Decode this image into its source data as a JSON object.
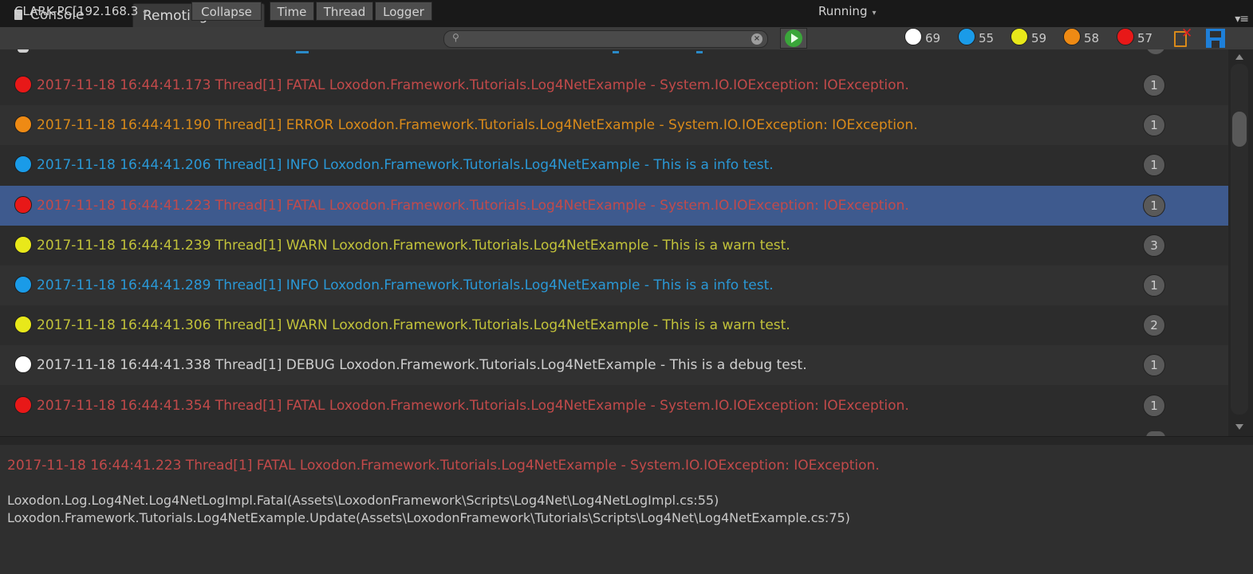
{
  "tabs": [
    {
      "label": "Console",
      "icon": "console-icon"
    },
    {
      "label": "Remoting"
    }
  ],
  "toolbar": {
    "device": "CLARK-PC[192.168.3",
    "collapse": "Collapse",
    "time": "Time",
    "thread": "Thread",
    "logger": "Logger",
    "search_value": "",
    "status": "Running",
    "counts": {
      "debug": "69",
      "info": "55",
      "warn": "59",
      "error": "58",
      "fatal": "57"
    }
  },
  "colors": {
    "debug": "#ffffff",
    "info": "#1a9be8",
    "warn": "#e8e81a",
    "error": "#ee8a14",
    "fatal": "#e81818",
    "text_fatal": "#c24a4a",
    "text_error": "#d98a1a",
    "text_info": "#2a98d6",
    "text_warn": "#c2c23a",
    "text_debug": "#cfcfcf",
    "selected_row": "#3e5a8e"
  },
  "log_rows": [
    {
      "level": "fatal",
      "text": "2017-11-18 16:44:41.173 Thread[1] FATAL Loxodon.Framework.Tutorials.Log4NetExample - System.IO.IOException: IOException.",
      "count": "1"
    },
    {
      "level": "error",
      "text": "2017-11-18 16:44:41.190 Thread[1] ERROR Loxodon.Framework.Tutorials.Log4NetExample - System.IO.IOException: IOException.",
      "count": "1"
    },
    {
      "level": "info",
      "text": "2017-11-18 16:44:41.206 Thread[1] INFO Loxodon.Framework.Tutorials.Log4NetExample - This is a info test.",
      "count": "1"
    },
    {
      "level": "fatal",
      "text": "2017-11-18 16:44:41.223 Thread[1] FATAL Loxodon.Framework.Tutorials.Log4NetExample - System.IO.IOException: IOException.",
      "count": "1",
      "selected": true
    },
    {
      "level": "warn",
      "text": "2017-11-18 16:44:41.239 Thread[1] WARN Loxodon.Framework.Tutorials.Log4NetExample - This is a warn test.",
      "count": "3"
    },
    {
      "level": "info",
      "text": "2017-11-18 16:44:41.289 Thread[1] INFO Loxodon.Framework.Tutorials.Log4NetExample - This is a info test.",
      "count": "1"
    },
    {
      "level": "warn",
      "text": "2017-11-18 16:44:41.306 Thread[1] WARN Loxodon.Framework.Tutorials.Log4NetExample - This is a warn test.",
      "count": "2"
    },
    {
      "level": "debug",
      "text": "2017-11-18 16:44:41.338 Thread[1] DEBUG Loxodon.Framework.Tutorials.Log4NetExample - This is a debug test.",
      "count": "1"
    },
    {
      "level": "fatal",
      "text": "2017-11-18 16:44:41.354 Thread[1] FATAL Loxodon.Framework.Tutorials.Log4NetExample - System.IO.IOException: IOException.",
      "count": "1"
    }
  ],
  "detail": {
    "header": "2017-11-18 16:44:41.223 Thread[1] FATAL Loxodon.Framework.Tutorials.Log4NetExample - System.IO.IOException: IOException.",
    "stack": [
      "Loxodon.Log.Log4Net.Log4NetLogImpl.Fatal(Assets\\LoxodonFramework\\Scripts\\Log4Net\\Log4NetLogImpl.cs:55)",
      "Loxodon.Framework.Tutorials.Log4NetExample.Update(Assets\\LoxodonFramework\\Tutorials\\Scripts\\Log4Net\\Log4NetExample.cs:75)"
    ]
  }
}
